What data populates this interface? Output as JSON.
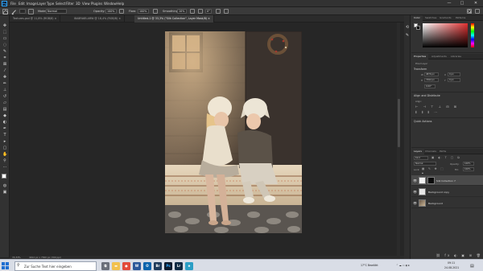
{
  "app": {
    "logo": "Ps",
    "menu": [
      "File",
      "Edit",
      "Image",
      "Layer",
      "Type",
      "Select",
      "Filter",
      "3D",
      "View",
      "Plugins",
      "Window",
      "Help"
    ],
    "window_controls": [
      "—",
      "□",
      "✕"
    ]
  },
  "options_bar": {
    "mode_label": "Mode:",
    "mode_value": "Normal",
    "opacity_label": "Opacity:",
    "opacity_value": "100%",
    "flow_label": "Flow:",
    "flow_value": "100%",
    "smoothing_label": "Smoothing:",
    "smoothing_value": "10%",
    "angle_value": "0°"
  },
  "tabs": [
    {
      "label": "Textures.psd @ 11,8% (RGB/8) ×"
    },
    {
      "label": "I8A8FA6B.ARW @ 18,4% (RGB/8) ×"
    },
    {
      "label": "Untitled-1 @ 33,3% (\"Silk Collection\", Layer Mask/8) ×"
    }
  ],
  "status": {
    "zoom": "33,33%",
    "doc_info": "4912 px x 7360 px (300 ppi)"
  },
  "right_panel": {
    "color_tabs": [
      "Color",
      "Swatches",
      "Gradients",
      "Patterns"
    ],
    "properties_tabs": [
      "Properties",
      "Adjustments",
      "Libraries"
    ],
    "pixel_layer_label": "Pixel Layer",
    "transform_label": "Transform",
    "w_label": "W",
    "w_value": "4876 px",
    "h_label": "H",
    "h_value": "7292 px",
    "x_label": "X",
    "x_value": "0 px",
    "y_label": "Y",
    "y_value": "0 px",
    "angle_value": "0,00°",
    "align_label": "Align and Distribute",
    "align_sub": "Align:",
    "quick_actions_label": "Quick Actions",
    "layers_tabs": [
      "Layers",
      "Channels",
      "Paths"
    ],
    "kind_label": "Kind",
    "blend_mode": "Normal",
    "opacity_label": "Opacity:",
    "opacity_value": "100%",
    "lock_label": "Lock:",
    "fill_label": "Fill:",
    "fill_value": "100%"
  },
  "layers": [
    {
      "name": "Silk Collection 7"
    },
    {
      "name": "Background copy"
    },
    {
      "name": "Background"
    }
  ],
  "taskbar": {
    "search_placeholder": "Zur Suche Text hier eingeben",
    "weather": "17°C  Bewölkt",
    "time": "09:11",
    "date": "24.08.2021",
    "apps": [
      {
        "name": "task-view",
        "color": "#6a6f7a",
        "glyph": "⧉"
      },
      {
        "name": "explorer",
        "color": "#f2c14e",
        "glyph": "▬"
      },
      {
        "name": "chrome",
        "color": "#e24a3b",
        "glyph": "●"
      },
      {
        "name": "word",
        "color": "#2b579a",
        "glyph": "W"
      },
      {
        "name": "outlook",
        "color": "#0a64ad",
        "glyph": "O"
      },
      {
        "name": "bridge",
        "color": "#1f3a5b",
        "glyph": "Br"
      },
      {
        "name": "photoshop",
        "color": "#0d1b2e",
        "glyph": "Ps"
      },
      {
        "name": "lightroom",
        "color": "#0f2a44",
        "glyph": "Lr"
      },
      {
        "name": "edge",
        "color": "#2b9ec5",
        "glyph": "e"
      }
    ]
  },
  "colors": {
    "ps_blue": "#31a8ff",
    "foreground": "#ffffff",
    "background": "#000000",
    "picker_hue": "#e03030"
  }
}
